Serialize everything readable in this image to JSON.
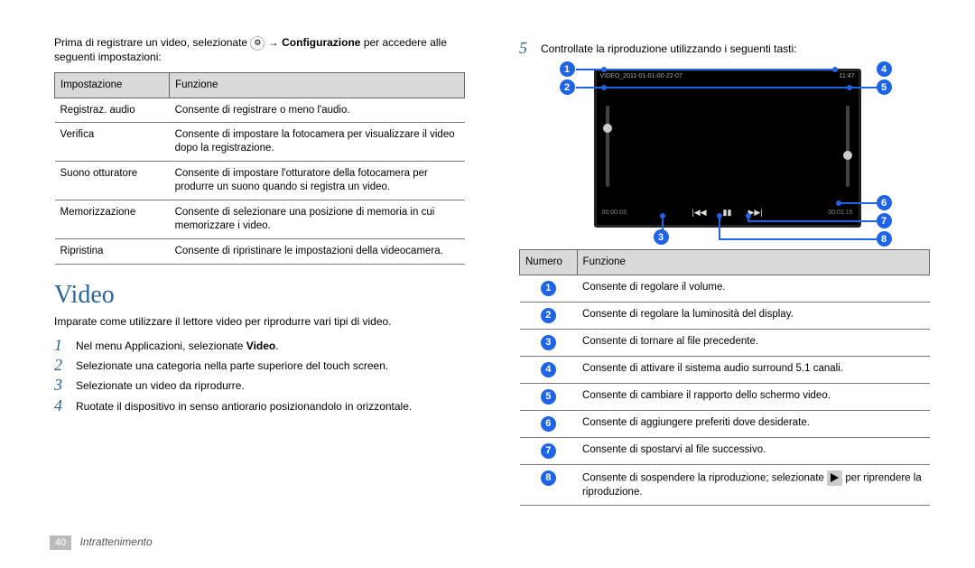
{
  "left": {
    "intro_part1": "Prima di registrare un video, selezionate ",
    "intro_gear": "⚙",
    "intro_arrow": " → ",
    "intro_bold": "Configurazione",
    "intro_part2": " per accedere alle seguenti impostazioni:",
    "settings_headers": {
      "col1": "Impostazione",
      "col2": "Funzione"
    },
    "settings_rows": [
      {
        "k": "Registraz. audio",
        "v": "Consente di registrare o meno l'audio."
      },
      {
        "k": "Verifica",
        "v": "Consente di impostare la fotocamera per visualizzare il video dopo la registrazione."
      },
      {
        "k": "Suono otturatore",
        "v": "Consente di impostare l'otturatore della fotocamera per produrre un suono quando si registra un video."
      },
      {
        "k": "Memorizzazione",
        "v": "Consente di selezionare una posizione di memoria in cui memorizzare i video."
      },
      {
        "k": "Ripristina",
        "v": "Consente di ripristinare le impostazioni della videocamera."
      }
    ],
    "heading": "Video",
    "body": "Imparate come utilizzare il lettore video per riprodurre vari tipi di video.",
    "steps": [
      {
        "n": "1",
        "pre": "Nel menu Applicazioni, selezionate ",
        "bold": "Video",
        "post": "."
      },
      {
        "n": "2",
        "pre": "Selezionate una categoria nella parte superiore del touch screen.",
        "bold": "",
        "post": ""
      },
      {
        "n": "3",
        "pre": "Selezionate un video da riprodurre.",
        "bold": "",
        "post": ""
      },
      {
        "n": "4",
        "pre": "Ruotate il dispositivo in senso antiorario posizionandolo in orizzontale.",
        "bold": "",
        "post": ""
      }
    ]
  },
  "right": {
    "step5": {
      "n": "5",
      "text": "Controllate la riproduzione utilizzando i seguenti tasti:"
    },
    "diagram": {
      "status_left": "VIDEO_2011-01-01-00-22-07",
      "status_right": "11:47",
      "time_left": "00:00:03",
      "time_right": "00:01:15",
      "prev": "|◀◀",
      "pause": "▮▮",
      "next": "▶▶|",
      "labels": [
        "1",
        "2",
        "3",
        "4",
        "5",
        "6",
        "7",
        "8"
      ]
    },
    "func_headers": {
      "col1": "Numero",
      "col2": "Funzione"
    },
    "func_rows": [
      {
        "n": "1",
        "v": "Consente di regolare il volume."
      },
      {
        "n": "2",
        "v": "Consente di regolare la luminosità del display."
      },
      {
        "n": "3",
        "v": "Consente di tornare al file precedente."
      },
      {
        "n": "4",
        "v": "Consente di attivare il sistema audio surround 5.1 canali."
      },
      {
        "n": "5",
        "v": "Consente di cambiare il rapporto dello schermo video."
      },
      {
        "n": "6",
        "v": "Consente di aggiungere preferiti dove desiderate."
      },
      {
        "n": "7",
        "v": "Consente di spostarvi al file successivo."
      },
      {
        "n": "8",
        "v_pre": "Consente di sospendere la riproduzione; selezionate ",
        "v_post": " per riprendere la riproduzione."
      }
    ]
  },
  "footer": {
    "page": "40",
    "section": "Intrattenimento"
  }
}
